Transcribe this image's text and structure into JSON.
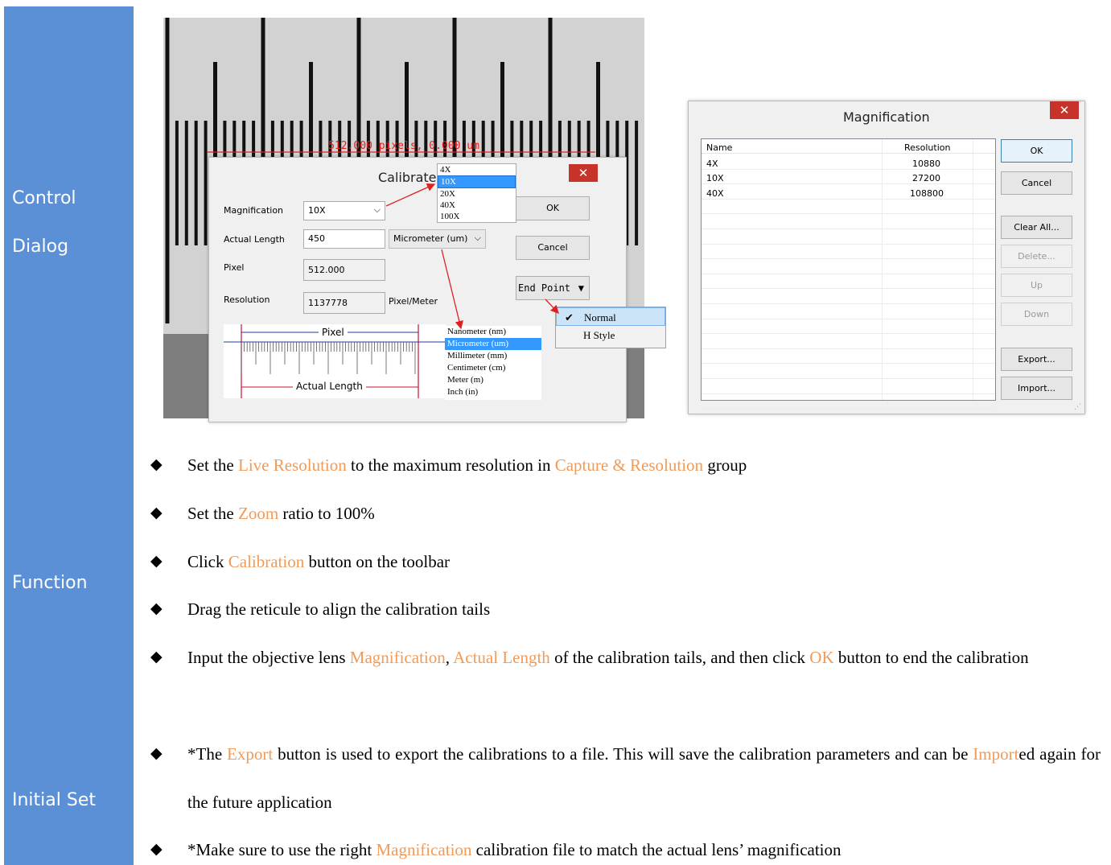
{
  "sidebar": {
    "control_dialog_line1": "Control",
    "control_dialog_line2": "Dialog",
    "function": "Function",
    "initial_set": "Initial Set",
    "bg_color": "#5b8fd6"
  },
  "scope_image": {
    "measurement": "512.000 pixels, 0.000 um"
  },
  "calibrate_dialog": {
    "title": "Calibrate",
    "close_icon": "✕",
    "magnification_label": "Magnification",
    "magnification_value": "10X",
    "magnification_options": [
      "4X",
      "10X",
      "20X",
      "40X",
      "100X"
    ],
    "actual_length_label": "Actual Length",
    "actual_length_value": "450",
    "unit_value": "Micrometer (um)",
    "unit_options": [
      "Nanometer (nm)",
      "Micrometer (um)",
      "Millimeter (mm)",
      "Centimeter (cm)",
      "Meter (m)",
      "Inch (in)"
    ],
    "pixel_label": "Pixel",
    "pixel_value": "512.000",
    "resolution_label": "Resolution",
    "resolution_value": "1137778",
    "resolution_unit": "Pixel/Meter",
    "diagram_pixel": "Pixel",
    "diagram_actual_length": "Actual Length",
    "ok": "OK",
    "cancel": "Cancel",
    "end_point": "End Point",
    "end_point_options": [
      "Normal",
      "H Style"
    ]
  },
  "magnification_dialog": {
    "title": "Magnification",
    "close_icon": "✕",
    "columns": [
      "Name",
      "Resolution"
    ],
    "rows": [
      {
        "name": "4X",
        "resolution": "10880"
      },
      {
        "name": "10X",
        "resolution": "27200"
      },
      {
        "name": "40X",
        "resolution": "108800"
      }
    ],
    "buttons": {
      "ok": "OK",
      "cancel": "Cancel",
      "clear_all": "Clear All...",
      "delete": "Delete...",
      "up": "Up",
      "down": "Down",
      "export": "Export...",
      "import": "Import..."
    }
  },
  "bullet_symbol": "◆",
  "bullets": {
    "b1": {
      "t1": "Set the ",
      "h1": "Live Resolution",
      "t2": " to the maximum resolution in ",
      "h2": "Capture & Resolution",
      "t3": " group"
    },
    "b2": {
      "t1": "Set the ",
      "h1": "Zoom",
      "t2": " ratio to 100%"
    },
    "b3": {
      "t1": "Click ",
      "h1": "Calibration",
      "t2": " button on the toolbar"
    },
    "b4": {
      "t1": "Drag the reticule to align the calibration tails"
    },
    "b5": {
      "t1": "Input the objective lens ",
      "h1": "Magnification",
      "t2": ", ",
      "h2": "Actual Length",
      "t3": " of the calibration tails, and then click ",
      "h3": "OK",
      "t4": " button to end the calibration"
    },
    "b6": {
      "t1": "*The ",
      "h1": "Export",
      "t2": " button is used to export the calibrations to a file. This will save the calibration parameters and can be ",
      "h2": "Import",
      "t3": "ed again for the future application"
    },
    "b7": {
      "t1": "*Make sure to use the right ",
      "h1": "Magnification",
      "t2": " calibration file to match the actual lens’ magnification"
    }
  },
  "colors": {
    "highlight": "#f29a57",
    "arrow": "#e02020",
    "selection": "#3399ff"
  }
}
